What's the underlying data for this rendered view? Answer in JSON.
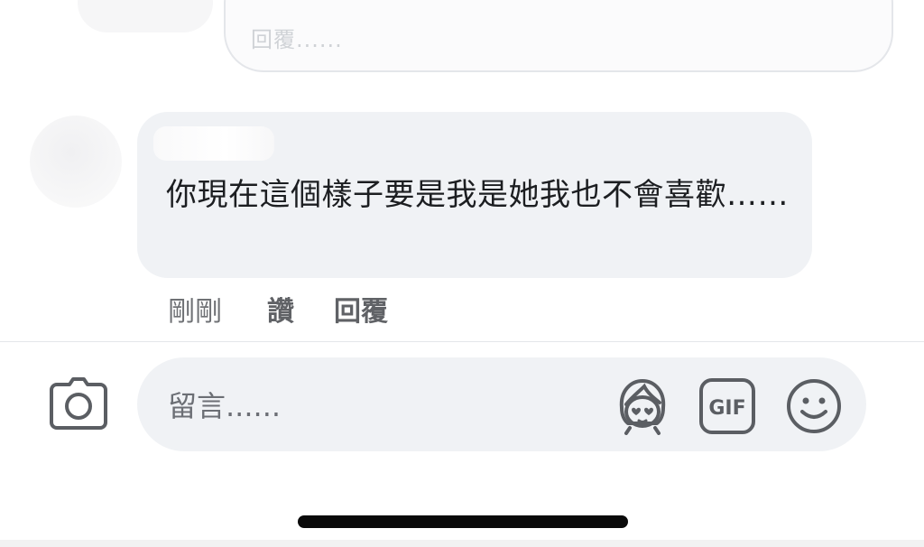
{
  "previous_reply": {
    "placeholder": "回覆......"
  },
  "comment": {
    "author": "",
    "text": "你現在這個樣子要是我是她我也不會喜歡……",
    "time": "剛剛",
    "like_label": "讚",
    "reply_label": "回覆"
  },
  "composer": {
    "placeholder": "留言......",
    "icons": [
      "camera-icon",
      "avatar-sticker-icon",
      "gif-icon",
      "emoji-icon"
    ]
  },
  "colors": {
    "bubble": "#f0f2f5",
    "secondary_text": "#65676b",
    "primary_text": "#1c1e21"
  }
}
